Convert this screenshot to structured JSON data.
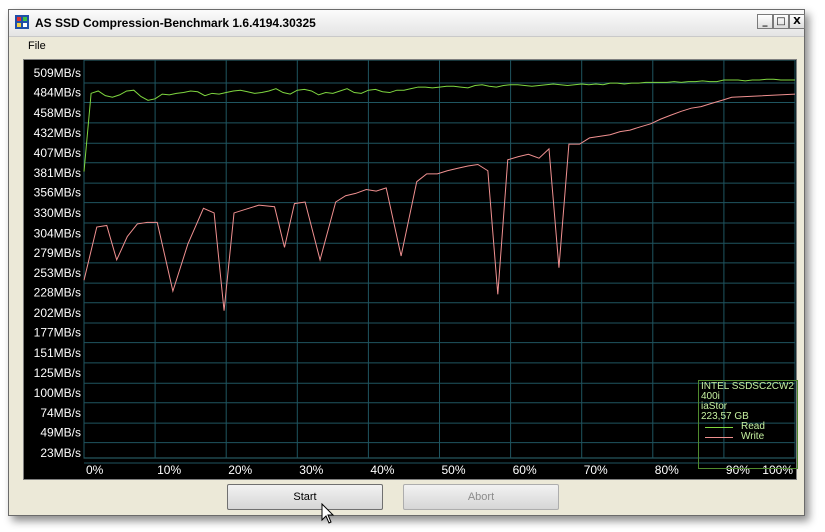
{
  "window": {
    "title": "AS SSD Compression-Benchmark 1.6.4194.30325",
    "controls": {
      "minimize": "_",
      "maximize": "□",
      "close": "X"
    }
  },
  "menu": {
    "file": "File"
  },
  "chart_data": {
    "type": "line",
    "title": "",
    "xlabel": "",
    "ylabel": "",
    "y_tick_labels": [
      "509MB/s",
      "484MB/s",
      "458MB/s",
      "432MB/s",
      "407MB/s",
      "381MB/s",
      "356MB/s",
      "330MB/s",
      "304MB/s",
      "279MB/s",
      "253MB/s",
      "228MB/s",
      "202MB/s",
      "177MB/s",
      "151MB/s",
      "125MB/s",
      "100MB/s",
      "74MB/s",
      "49MB/s",
      "23MB/s"
    ],
    "y_tick_values": [
      509,
      484,
      458,
      432,
      407,
      381,
      356,
      330,
      304,
      279,
      253,
      228,
      202,
      177,
      151,
      125,
      100,
      74,
      49,
      23
    ],
    "x_tick_labels": [
      "0%",
      "10%",
      "20%",
      "30%",
      "40%",
      "50%",
      "60%",
      "70%",
      "80%",
      "90%",
      "100%"
    ],
    "x_tick_values": [
      0,
      10,
      20,
      30,
      40,
      50,
      60,
      70,
      80,
      90,
      100
    ],
    "xlim": [
      0,
      100
    ],
    "ylim": [
      0,
      525
    ],
    "grid": true,
    "legend_position": "bottom-right",
    "x": [
      0,
      1,
      2,
      3,
      4,
      5,
      6,
      7,
      8,
      9,
      10,
      11,
      12,
      13,
      14,
      15,
      16,
      17,
      18,
      19,
      20,
      21,
      22,
      23,
      24,
      25,
      26,
      27,
      28,
      29,
      30,
      31,
      32,
      33,
      34,
      35,
      36,
      37,
      38,
      39,
      40,
      41,
      42,
      43,
      44,
      45,
      46,
      47,
      48,
      49,
      50,
      51,
      52,
      53,
      54,
      55,
      56,
      57,
      58,
      59,
      60,
      61,
      62,
      63,
      64,
      65,
      66,
      67,
      68,
      69,
      70,
      71,
      72,
      73,
      74,
      75,
      76,
      77,
      78,
      79,
      80,
      81,
      82,
      83,
      84,
      85,
      86,
      87,
      88,
      89,
      90,
      91,
      92,
      93,
      94,
      95,
      96,
      97,
      98,
      99,
      100
    ],
    "series": [
      {
        "name": "Read",
        "color": "#7fd640",
        "values": [
          383,
          483,
          486,
          480,
          478,
          481,
          486,
          487,
          479,
          474,
          476,
          482,
          481,
          483,
          484,
          486,
          485,
          480,
          483,
          482,
          484,
          486,
          487,
          485,
          483,
          484,
          486,
          489,
          484,
          482,
          487,
          488,
          486,
          481,
          484,
          483,
          486,
          489,
          484,
          483,
          487,
          488,
          485,
          484,
          487,
          487,
          489,
          491,
          491,
          490,
          491,
          492,
          492,
          491,
          490,
          493,
          494,
          492,
          491,
          493,
          494,
          494,
          493,
          492,
          493,
          494,
          495,
          494,
          493,
          494,
          495,
          494,
          495,
          494,
          496,
          496,
          495,
          496,
          496,
          497,
          497,
          497,
          497,
          498,
          497,
          498,
          498,
          499,
          498,
          498,
          500,
          500,
          500,
          499,
          500,
          500,
          501,
          501,
          500,
          500,
          500
        ]
      },
      {
        "name": "Write",
        "color": "#f09090",
        "values": [
          244,
          312,
          314,
          270,
          300,
          316,
          318,
          318,
          230,
          290,
          336,
          330,
          205,
          330,
          334,
          340,
          338,
          286,
          342,
          344,
          270,
          344,
          352,
          355,
          360,
          358,
          362,
          275,
          370,
          380,
          380,
          384,
          387,
          390,
          392,
          384,
          226,
          398,
          402,
          405,
          400,
          412,
          260,
          418,
          418,
          426,
          428,
          430,
          434,
          436,
          440,
          444,
          450,
          455,
          460,
          464,
          466,
          470,
          474,
          478,
          482
        ]
      }
    ],
    "write_x": [
      0,
      1.8,
      3.2,
      4.6,
      6.1,
      7.5,
      8.9,
      10.3,
      12.5,
      14.6,
      16.8,
      18.3,
      19.7,
      21.1,
      22.5,
      24.6,
      26.8,
      28.2,
      29.6,
      31.1,
      33.2,
      35.4,
      36.8,
      38.2,
      39.7,
      41.1,
      42.5,
      44.6,
      46.8,
      48.2,
      49.7,
      51.1,
      52.5,
      54.0,
      55.4,
      56.8,
      58.2,
      59.6,
      61.1,
      62.5,
      64.0,
      65.4,
      66.8,
      68.2,
      69.7,
      71.1,
      72.5,
      74.0,
      75.4,
      76.8,
      78.2,
      79.7,
      81.1,
      82.5,
      84.0,
      85.4,
      86.8,
      88.2,
      89.7,
      91.1,
      100
    ],
    "device_info": [
      "INTEL SSDSC2CW2",
      "400i",
      "iaStor",
      "223,57 GB"
    ],
    "legend": {
      "read": "Read",
      "write": "Write"
    }
  },
  "buttons": {
    "start": "Start",
    "abort": "Abort"
  }
}
